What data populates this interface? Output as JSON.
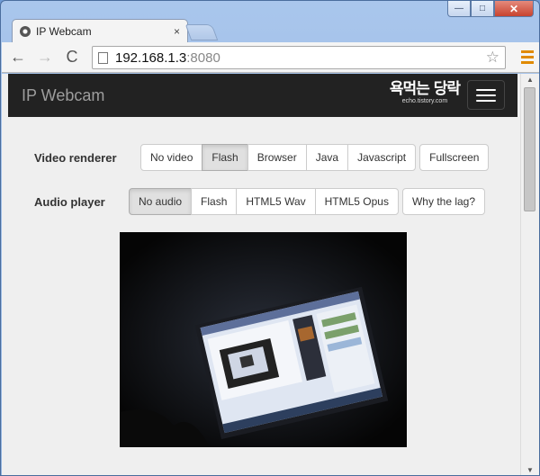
{
  "browser": {
    "tab_title": "IP Webcam",
    "tab_close": "×",
    "url_host": "192.168.1.3",
    "url_port": ":8080",
    "back": "←",
    "forward": "→",
    "reload": "C",
    "star": "☆",
    "win_min": "—",
    "win_max": "□",
    "win_close": "✕"
  },
  "navbar": {
    "brand": "IP Webcam",
    "logo_text": "욕먹는 당락",
    "logo_sub": "echo.tistory.com"
  },
  "video_renderer": {
    "label": "Video renderer",
    "options": [
      "No video",
      "Flash",
      "Browser",
      "Java",
      "Javascript"
    ],
    "selected": "Flash",
    "fullscreen": "Fullscreen"
  },
  "audio_player": {
    "label": "Audio player",
    "options": [
      "No audio",
      "Flash",
      "HTML5 Wav",
      "HTML5 Opus"
    ],
    "selected": "No audio",
    "why_lag": "Why the lag?"
  },
  "colors": {
    "navbar_bg": "#222222",
    "page_bg": "#efefef",
    "menu_accent": "#e08a00"
  }
}
